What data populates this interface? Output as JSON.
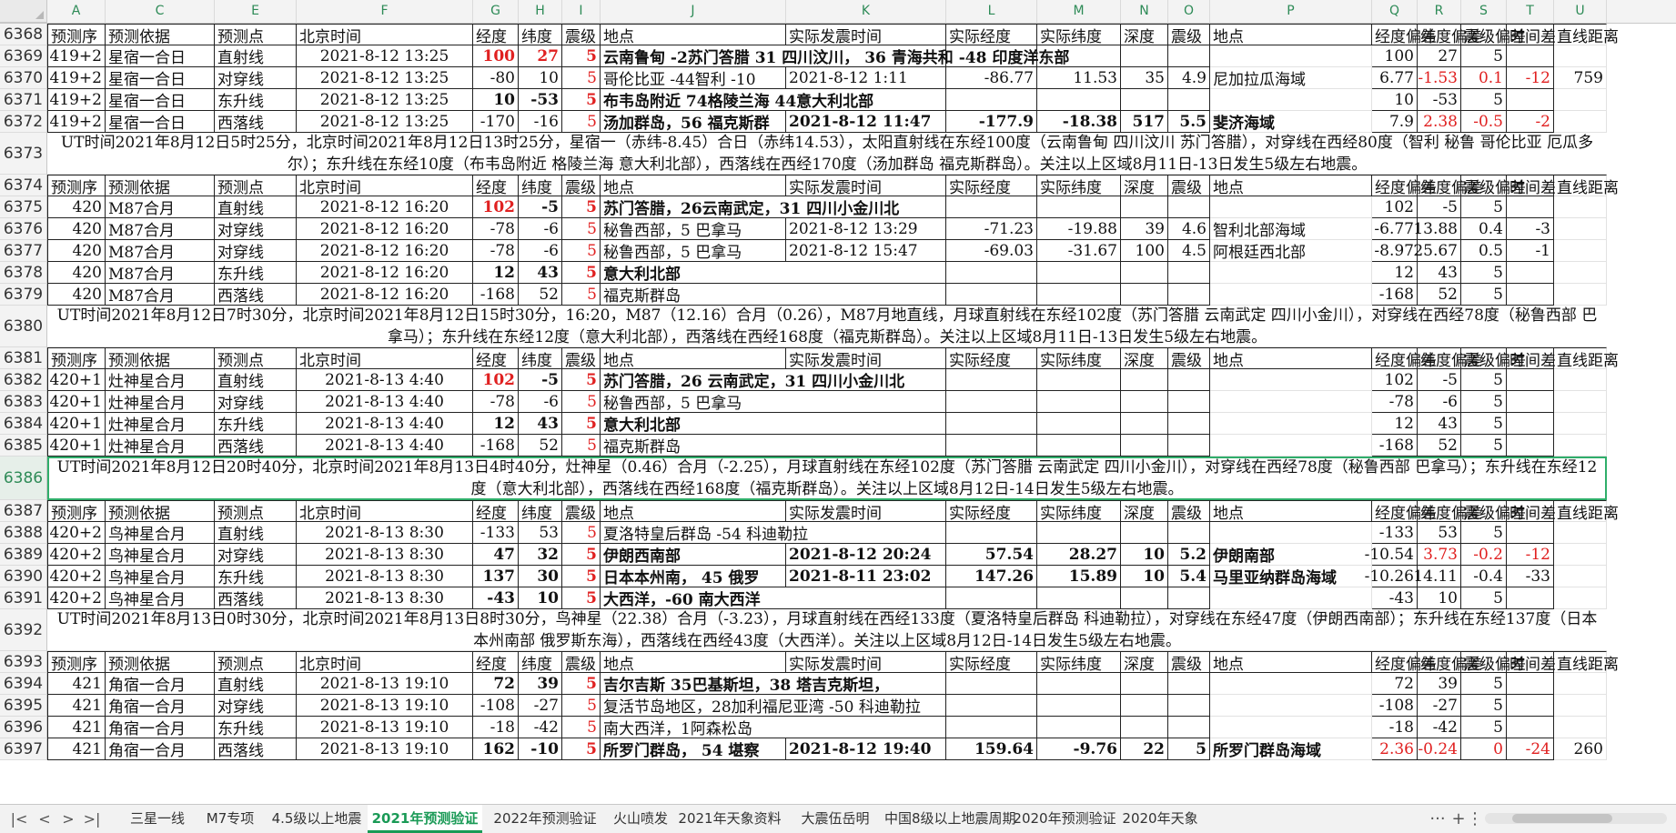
{
  "columns": [
    "A",
    "C",
    "E",
    "F",
    "G",
    "H",
    "I",
    "J",
    "K",
    "L",
    "M",
    "N",
    "O",
    "P",
    "Q",
    "R",
    "S",
    "T",
    "U"
  ],
  "rows": [
    {
      "num": "6368",
      "type": "header",
      "cells": [
        "预测序",
        "预测依据",
        "预测点",
        "北京时间",
        "经度",
        "纬度",
        "震级",
        "地点",
        "实际发震时间",
        "实际经度",
        "实际纬度",
        "深度",
        "震级",
        "地点",
        "经度偏差",
        "纬度偏差",
        "震级偏差",
        "时间差",
        "直线距离"
      ]
    },
    {
      "num": "6369",
      "type": "data",
      "cells": [
        "419+2",
        "星宿一合日",
        "直射线",
        "2021-8-12 13:25",
        "100",
        "27",
        "5",
        "云南鲁甸 -2苏门答腊  31 四川汶川，  36 青海共和 -48 印度洋东部",
        "",
        "",
        "",
        "",
        "",
        "",
        "100",
        "27",
        "5",
        "",
        ""
      ]
    },
    {
      "num": "6370",
      "type": "data",
      "cells": [
        "419+2",
        "星宿一合日",
        "对穿线",
        "2021-8-12 13:25",
        "-80",
        "10",
        "5",
        "哥伦比亚 -44智利 -10",
        "2021-8-12 1:11",
        "-86.77",
        "11.53",
        "35",
        "4.9",
        "尼加拉瓜海域",
        "6.77",
        "-1.53",
        "0.1",
        "-12",
        "759"
      ]
    },
    {
      "num": "6371",
      "type": "data",
      "cells": [
        "419+2",
        "星宿一合日",
        "东升线",
        "2021-8-12 13:25",
        "10",
        "-53",
        "5",
        "布韦岛附近 74格陵兰海 44意大利北部",
        "",
        "",
        "",
        "",
        "",
        "",
        "10",
        "-53",
        "5",
        "",
        ""
      ]
    },
    {
      "num": "6372",
      "type": "data",
      "cells": [
        "419+2",
        "星宿一合日",
        "西落线",
        "2021-8-12 13:25",
        "-170",
        "-16",
        "5",
        "汤加群岛，56 福克斯群",
        "2021-8-12 11:47",
        "-177.9",
        "-18.38",
        "517",
        "5.5",
        "斐济海域",
        "7.9",
        "2.38",
        "-0.5",
        "-2",
        ""
      ]
    },
    {
      "num": "6373",
      "type": "note",
      "text": "UT时间2021年8月12日5时25分，北京时间2021年8月12日13时25分，星宿一（赤纬-8.45）合日（赤纬14.53），太阳直射线在东经100度（云南鲁甸 四川汶川 苏门答腊），对穿线在西经80度（智利 秘鲁 哥伦比亚 厄瓜多尔）；东升线在东经10度（布韦岛附近 格陵兰海 意大利北部），西落线在西经170度（汤加群岛 福克斯群岛）。关注以上区域8月11日-13日发生5级左右地震。"
    },
    {
      "num": "6374",
      "type": "header",
      "cells": [
        "预测序",
        "预测依据",
        "预测点",
        "北京时间",
        "经度",
        "纬度",
        "震级",
        "地点",
        "实际发震时间",
        "实际经度",
        "实际纬度",
        "深度",
        "震级",
        "地点",
        "经度偏差",
        "纬度偏差",
        "震级偏差",
        "时间差",
        "直线距离"
      ]
    },
    {
      "num": "6375",
      "type": "data",
      "cells": [
        "420",
        "M87合月",
        "直射线",
        "2021-8-12 16:20",
        "102",
        "-5",
        "5",
        "苏门答腊，26云南武定，31 四川小金川北",
        "",
        "",
        "",
        "",
        "",
        "",
        "102",
        "-5",
        "5",
        "",
        ""
      ]
    },
    {
      "num": "6376",
      "type": "data",
      "cells": [
        "420",
        "M87合月",
        "对穿线",
        "2021-8-12 16:20",
        "-78",
        "-6",
        "5",
        "秘鲁西部，5 巴拿马",
        "2021-8-12 13:29",
        "-71.23",
        "-19.88",
        "39",
        "4.6",
        "智利北部海域",
        "-6.77",
        "13.88",
        "0.4",
        "-3",
        ""
      ]
    },
    {
      "num": "6377",
      "type": "data",
      "cells": [
        "420",
        "M87合月",
        "对穿线",
        "2021-8-12 16:20",
        "-78",
        "-6",
        "5",
        "秘鲁西部，5 巴拿马",
        "2021-8-12 15:47",
        "-69.03",
        "-31.67",
        "100",
        "4.5",
        "阿根廷西北部",
        "-8.97",
        "25.67",
        "0.5",
        "-1",
        ""
      ]
    },
    {
      "num": "6378",
      "type": "data",
      "cells": [
        "420",
        "M87合月",
        "东升线",
        "2021-8-12 16:20",
        "12",
        "43",
        "5",
        "意大利北部",
        "",
        "",
        "",
        "",
        "",
        "",
        "12",
        "43",
        "5",
        "",
        ""
      ]
    },
    {
      "num": "6379",
      "type": "data",
      "cells": [
        "420",
        "M87合月",
        "西落线",
        "2021-8-12 16:20",
        "-168",
        "52",
        "5",
        "福克斯群岛",
        "",
        "",
        "",
        "",
        "",
        "",
        "-168",
        "52",
        "5",
        "",
        ""
      ]
    },
    {
      "num": "6380",
      "type": "note",
      "text": "UT时间2021年8月12日7时30分，北京时间2021年8月12日15时30分，16:20，M87（12.16）合月（0.26），M87月地直线，月球直射线在东经102度（苏门答腊 云南武定 四川小金川），对穿线在西经78度（秘鲁西部 巴拿马）；东升线在东经12度（意大利北部），西落线在西经168度（福克斯群岛）。关注以上区域8月11日-13日发生5级左右地震。"
    },
    {
      "num": "6381",
      "type": "header",
      "cells": [
        "预测序",
        "预测依据",
        "预测点",
        "北京时间",
        "经度",
        "纬度",
        "震级",
        "地点",
        "实际发震时间",
        "实际经度",
        "实际纬度",
        "深度",
        "震级",
        "地点",
        "经度偏差",
        "纬度偏差",
        "震级偏差",
        "时间差",
        "直线距离"
      ]
    },
    {
      "num": "6382",
      "type": "data",
      "cells": [
        "420+1",
        "灶神星合月",
        "直射线",
        "2021-8-13 4:40",
        "102",
        "-5",
        "5",
        "苏门答腊，26 云南武定，31 四川小金川北",
        "",
        "",
        "",
        "",
        "",
        "",
        "102",
        "-5",
        "5",
        "",
        ""
      ]
    },
    {
      "num": "6383",
      "type": "data",
      "cells": [
        "420+1",
        "灶神星合月",
        "对穿线",
        "2021-8-13 4:40",
        "-78",
        "-6",
        "5",
        "秘鲁西部，5 巴拿马",
        "",
        "",
        "",
        "",
        "",
        "",
        "-78",
        "-6",
        "5",
        "",
        ""
      ]
    },
    {
      "num": "6384",
      "type": "data",
      "cells": [
        "420+1",
        "灶神星合月",
        "东升线",
        "2021-8-13 4:40",
        "12",
        "43",
        "5",
        "意大利北部",
        "",
        "",
        "",
        "",
        "",
        "",
        "12",
        "43",
        "5",
        "",
        ""
      ]
    },
    {
      "num": "6385",
      "type": "data",
      "cells": [
        "420+1",
        "灶神星合月",
        "西落线",
        "2021-8-13 4:40",
        "-168",
        "52",
        "5",
        "福克斯群岛",
        "",
        "",
        "",
        "",
        "",
        "",
        "-168",
        "52",
        "5",
        "",
        ""
      ]
    },
    {
      "num": "6386",
      "type": "note",
      "active": true,
      "text": "UT时间2021年8月12日20时40分，北京时间2021年8月13日4时40分，灶神星（0.46）合月（-2.25），月球直射线在东经102度（苏门答腊 云南武定 四川小金川），对穿线在西经78度（秘鲁西部 巴拿马）；东升线在东经12度（意大利北部），西落线在西经168度（福克斯群岛）。关注以上区域8月12日-14日发生5级左右地震。"
    },
    {
      "num": "6387",
      "type": "header",
      "cells": [
        "预测序",
        "预测依据",
        "预测点",
        "北京时间",
        "经度",
        "纬度",
        "震级",
        "地点",
        "实际发震时间",
        "实际经度",
        "实际纬度",
        "深度",
        "震级",
        "地点",
        "经度偏差",
        "纬度偏差",
        "震级偏差",
        "时间差",
        "直线距离"
      ]
    },
    {
      "num": "6388",
      "type": "data",
      "cells": [
        "420+2",
        "鸟神星合月",
        "直射线",
        "2021-8-13 8:30",
        "-133",
        "53",
        "5",
        "夏洛特皇后群岛 -54 科迪勒拉",
        "",
        "",
        "",
        "",
        "",
        "",
        "-133",
        "53",
        "5",
        "",
        ""
      ]
    },
    {
      "num": "6389",
      "type": "data",
      "cells": [
        "420+2",
        "鸟神星合月",
        "对穿线",
        "2021-8-13 8:30",
        "47",
        "32",
        "5",
        "伊朗西南部",
        "2021-8-12 20:24",
        "57.54",
        "28.27",
        "10",
        "5.2",
        "伊朗南部",
        "-10.54",
        "3.73",
        "-0.2",
        "-12",
        ""
      ]
    },
    {
      "num": "6390",
      "type": "data",
      "cells": [
        "420+2",
        "鸟神星合月",
        "东升线",
        "2021-8-13 8:30",
        "137",
        "30",
        "5",
        "日本本州南， 45 俄罗",
        "2021-8-11 23:02",
        "147.26",
        "15.89",
        "10",
        "5.4",
        "马里亚纳群岛海域",
        "-10.26",
        "14.11",
        "-0.4",
        "-33",
        ""
      ]
    },
    {
      "num": "6391",
      "type": "data",
      "cells": [
        "420+2",
        "鸟神星合月",
        "西落线",
        "2021-8-13 8:30",
        "-43",
        "10",
        "5",
        "大西洋，-60 南大西洋",
        "",
        "",
        "",
        "",
        "",
        "",
        "-43",
        "10",
        "5",
        "",
        ""
      ]
    },
    {
      "num": "6392",
      "type": "note",
      "text": "UT时间2021年8月13日0时30分，北京时间2021年8月13日8时30分，鸟神星（22.38）合月（-3.23），月球直射线在西经133度（夏洛特皇后群岛 科迪勒拉），对穿线在东经47度（伊朗西南部）；东升线在东经137度（日本本州南部 俄罗斯东海），西落线在西经43度（大西洋）。关注以上区域8月12日-14日发生5级左右地震。"
    },
    {
      "num": "6393",
      "type": "header",
      "cells": [
        "预测序",
        "预测依据",
        "预测点",
        "北京时间",
        "经度",
        "纬度",
        "震级",
        "地点",
        "实际发震时间",
        "实际经度",
        "实际纬度",
        "深度",
        "震级",
        "地点",
        "经度偏差",
        "纬度偏差",
        "震级偏差",
        "时间差",
        "直线距离"
      ]
    },
    {
      "num": "6394",
      "type": "data",
      "cells": [
        "421",
        "角宿一合月",
        "直射线",
        "2021-8-13 19:10",
        "72",
        "39",
        "5",
        "吉尔吉斯 35巴基斯坦，38 塔吉克斯坦，",
        "",
        "",
        "",
        "",
        "",
        "",
        "72",
        "39",
        "5",
        "",
        ""
      ]
    },
    {
      "num": "6395",
      "type": "data",
      "cells": [
        "421",
        "角宿一合月",
        "对穿线",
        "2021-8-13 19:10",
        "-108",
        "-27",
        "5",
        "复活节岛地区，28加利福尼亚湾 -50 科迪勒拉",
        "",
        "",
        "",
        "",
        "",
        "",
        "-108",
        "-27",
        "5",
        "",
        ""
      ]
    },
    {
      "num": "6396",
      "type": "data",
      "cells": [
        "421",
        "角宿一合月",
        "东升线",
        "2021-8-13 19:10",
        "-18",
        "-42",
        "5",
        "南大西洋，1阿森松岛",
        "",
        "",
        "",
        "",
        "",
        "",
        "-18",
        "-42",
        "5",
        "",
        ""
      ]
    },
    {
      "num": "6397",
      "type": "data",
      "cells": [
        "421",
        "角宿一合月",
        "西落线",
        "2021-8-13 19:10",
        "162",
        "-10",
        "5",
        "所罗门群岛， 54 堪察",
        "2021-8-12 19:40",
        "159.64",
        "-9.76",
        "22",
        "5",
        "所罗门群岛海域",
        "2.36",
        "-0.24",
        "0",
        "-24",
        "260"
      ]
    }
  ],
  "sheet_tabs": [
    "三星一线",
    "M7专项",
    "4.5级以上地震",
    "2021年预测验证",
    "2022年预测验证",
    "火山喷发",
    "2021年天象资料",
    "大震伍岳明",
    "中国8级以上地震周期",
    "2020年预测验证",
    "2020年天象"
  ],
  "active_tab": "2021年预测验证",
  "nav": {
    "first": "|<",
    "prev": "<",
    "next": ">",
    "last": ">|",
    "more": "···",
    "add": "+",
    "menu": "⋮"
  },
  "colors": {
    "accent": "#1a9a56",
    "red": "#e02020",
    "header_text": "#2e8b57"
  }
}
